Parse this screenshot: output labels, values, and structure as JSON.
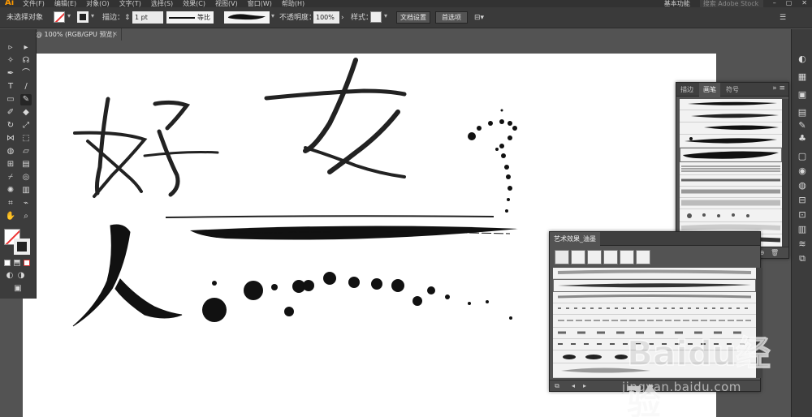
{
  "app": {
    "logo": "Ai"
  },
  "menubar": {
    "items": [
      "文件(F)",
      "编辑(E)",
      "对象(O)",
      "文字(T)",
      "选择(S)",
      "效果(C)",
      "视图(V)",
      "窗口(W)",
      "帮助(H)"
    ],
    "workspace": "基本功能",
    "search_placeholder": "搜索 Adobe Stock"
  },
  "controlbar": {
    "selection_status": "未选择对象",
    "stroke_label": "描边：",
    "stroke_weight": "1 pt",
    "stroke_profile": "等比",
    "opacity_label": "不透明度：",
    "opacity_value": "100%",
    "style_label": "样式：",
    "doc_setup_button": "文档设置",
    "prefs_button": "首选项"
  },
  "document_tab": {
    "title": "@ 100% (RGB/GPU 预览)",
    "close": "×"
  },
  "brushes_panel": {
    "tabs": [
      "描边",
      "画笔",
      "符号"
    ],
    "active_tab": "画笔",
    "rows": 12,
    "selected_row": 4
  },
  "art_library_panel": {
    "title": "艺术效果_油墨",
    "rows": 9,
    "selected_row": 1
  },
  "colors": {
    "panel_bg": "#535353",
    "toolbar_bg": "#3c3c3c",
    "menubar_bg": "#323232",
    "logo": "#ff9a00",
    "ink": "#111111"
  },
  "canvas": {
    "strokes": [
      "好",
      "女",
      "人"
    ]
  },
  "watermark": {
    "brand": "Baidu经验",
    "url": "jingyan.baidu.com"
  }
}
